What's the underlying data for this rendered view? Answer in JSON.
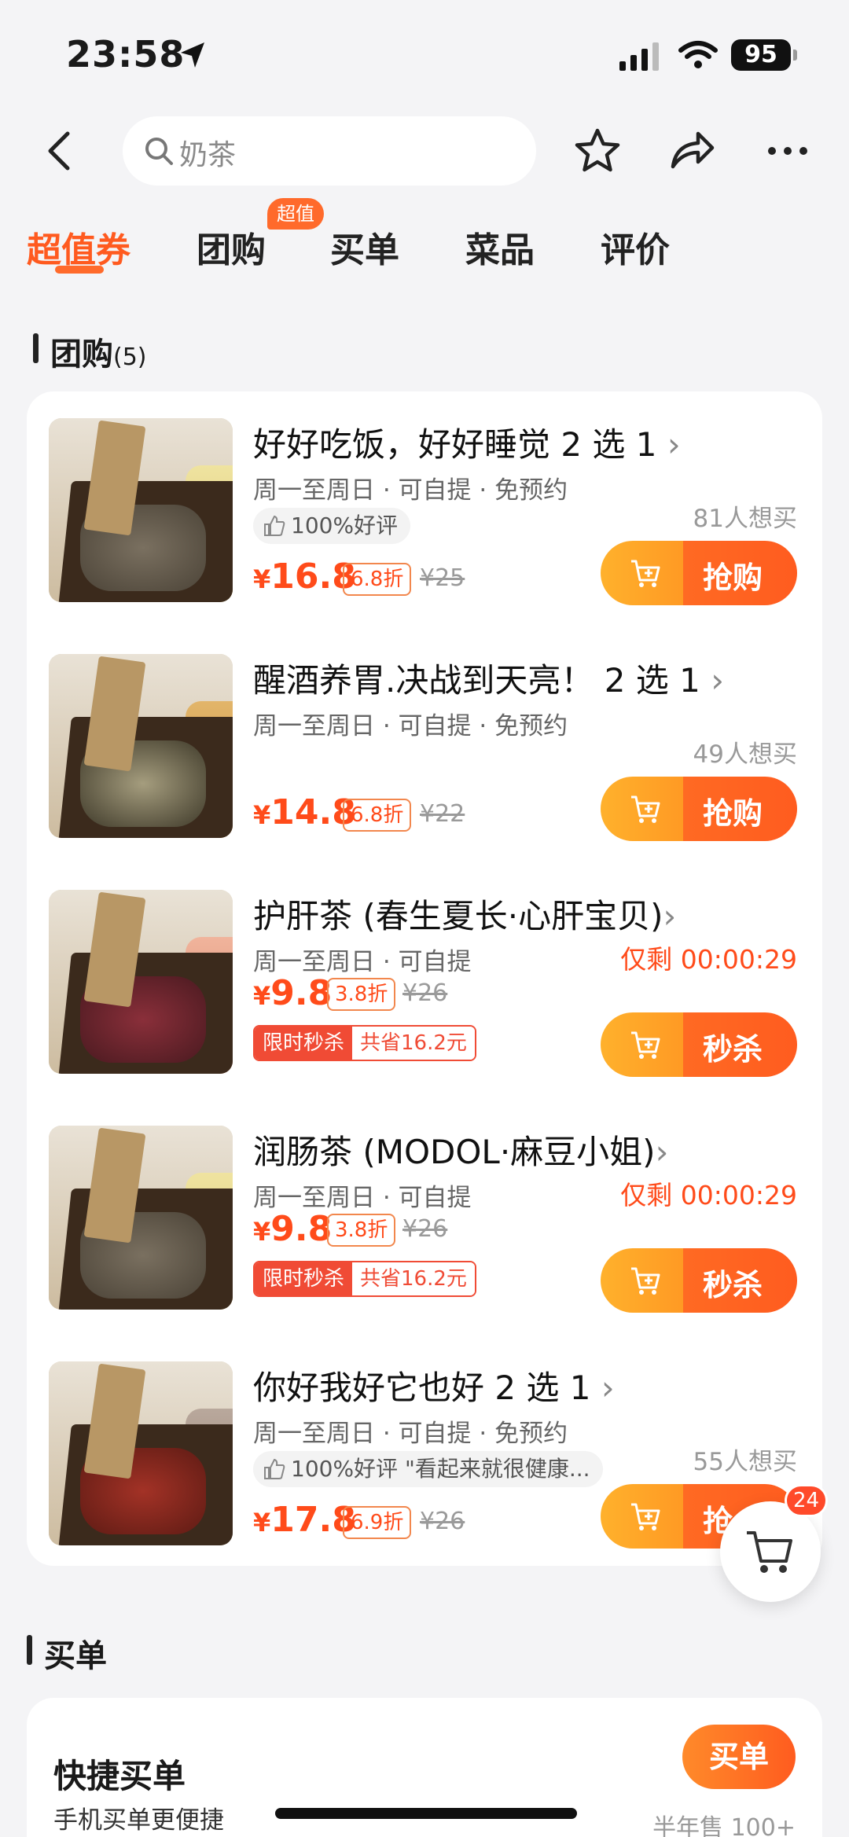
{
  "status": {
    "time": "23:58",
    "battery": "95"
  },
  "search": {
    "query": "奶茶"
  },
  "tabs": [
    {
      "label": "超值券",
      "active": true
    },
    {
      "label": "团购",
      "badge": "超值"
    },
    {
      "label": "买单"
    },
    {
      "label": "菜品"
    },
    {
      "label": "评价"
    }
  ],
  "groupbuy": {
    "title": "团购",
    "count": "(5)"
  },
  "deals": [
    {
      "title": "好好吃饭，好好睡觉 2 选 1",
      "sub": "周一至周日 · 可自提 · 免预约",
      "rating": "100%好评",
      "want": "81人想买",
      "yen": "¥",
      "price": "16.8",
      "discount": "6.8折",
      "orig": "¥25",
      "button": "抢购"
    },
    {
      "title": "醒酒养胃.决战到天亮！ 2 选 1",
      "sub": "周一至周日 · 可自提 · 免预约",
      "want": "49人想买",
      "yen": "¥",
      "price": "14.8",
      "discount": "6.8折",
      "orig": "¥22",
      "button": "抢购"
    },
    {
      "title": "护肝茶 (春生夏长·心肝宝贝)",
      "sub": "周一至周日 · 可自提",
      "countdown": "仅剩 00:00:29",
      "yen": "¥",
      "price": "9.8",
      "discount": "3.8折",
      "orig": "¥26",
      "flash_a": "限时秒杀",
      "flash_b": "共省16.2元",
      "button": "秒杀"
    },
    {
      "title": "润肠茶 (MODOL·麻豆小姐)",
      "sub": "周一至周日 · 可自提",
      "countdown": "仅剩 00:00:29",
      "yen": "¥",
      "price": "9.8",
      "discount": "3.8折",
      "orig": "¥26",
      "flash_a": "限时秒杀",
      "flash_b": "共省16.2元",
      "button": "秒杀"
    },
    {
      "title": "你好我好它也好 2 选 1",
      "sub": "周一至周日 · 可自提 · 免预约",
      "rating": "100%好评 \"看起来就很健康...",
      "want": "55人想买",
      "yen": "¥",
      "price": "17.8",
      "discount": "6.9折",
      "orig": "¥26",
      "button": "抢"
    }
  ],
  "cart_badge": "24",
  "maidan": {
    "section": "买单",
    "title": "快捷买单",
    "subtitle": "手机买单更便捷",
    "button": "买单",
    "sold": "半年售 100+"
  },
  "colors": {
    "accent": "#ff5a1f",
    "price": "#ff4b1a"
  }
}
